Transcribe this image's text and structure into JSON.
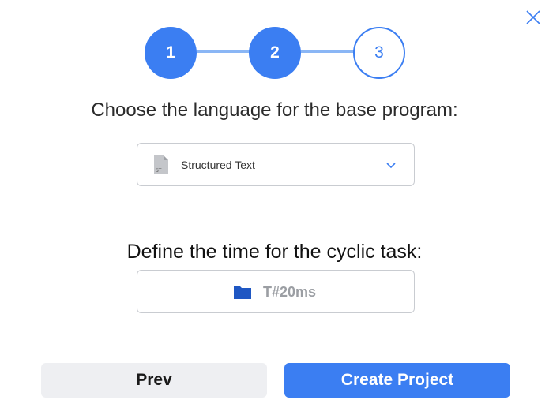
{
  "dialog": {
    "close_icon": "close-icon"
  },
  "stepper": {
    "steps": [
      {
        "label": "1",
        "state": "done"
      },
      {
        "label": "2",
        "state": "done"
      },
      {
        "label": "3",
        "state": "current"
      }
    ],
    "accent_color": "#3b7ef2",
    "line_color": "#8ab6f5"
  },
  "language": {
    "prompt": "Choose the language for the base program:",
    "selected": "Structured Text",
    "icon": "st-file-icon",
    "icon_badge": "ST",
    "dropdown_icon": "chevron-down-icon"
  },
  "cyclic_task": {
    "prompt": "Define the time for the cyclic task:",
    "value": "T#20ms",
    "icon": "folder-icon"
  },
  "footer": {
    "prev_label": "Prev",
    "create_label": "Create Project"
  }
}
